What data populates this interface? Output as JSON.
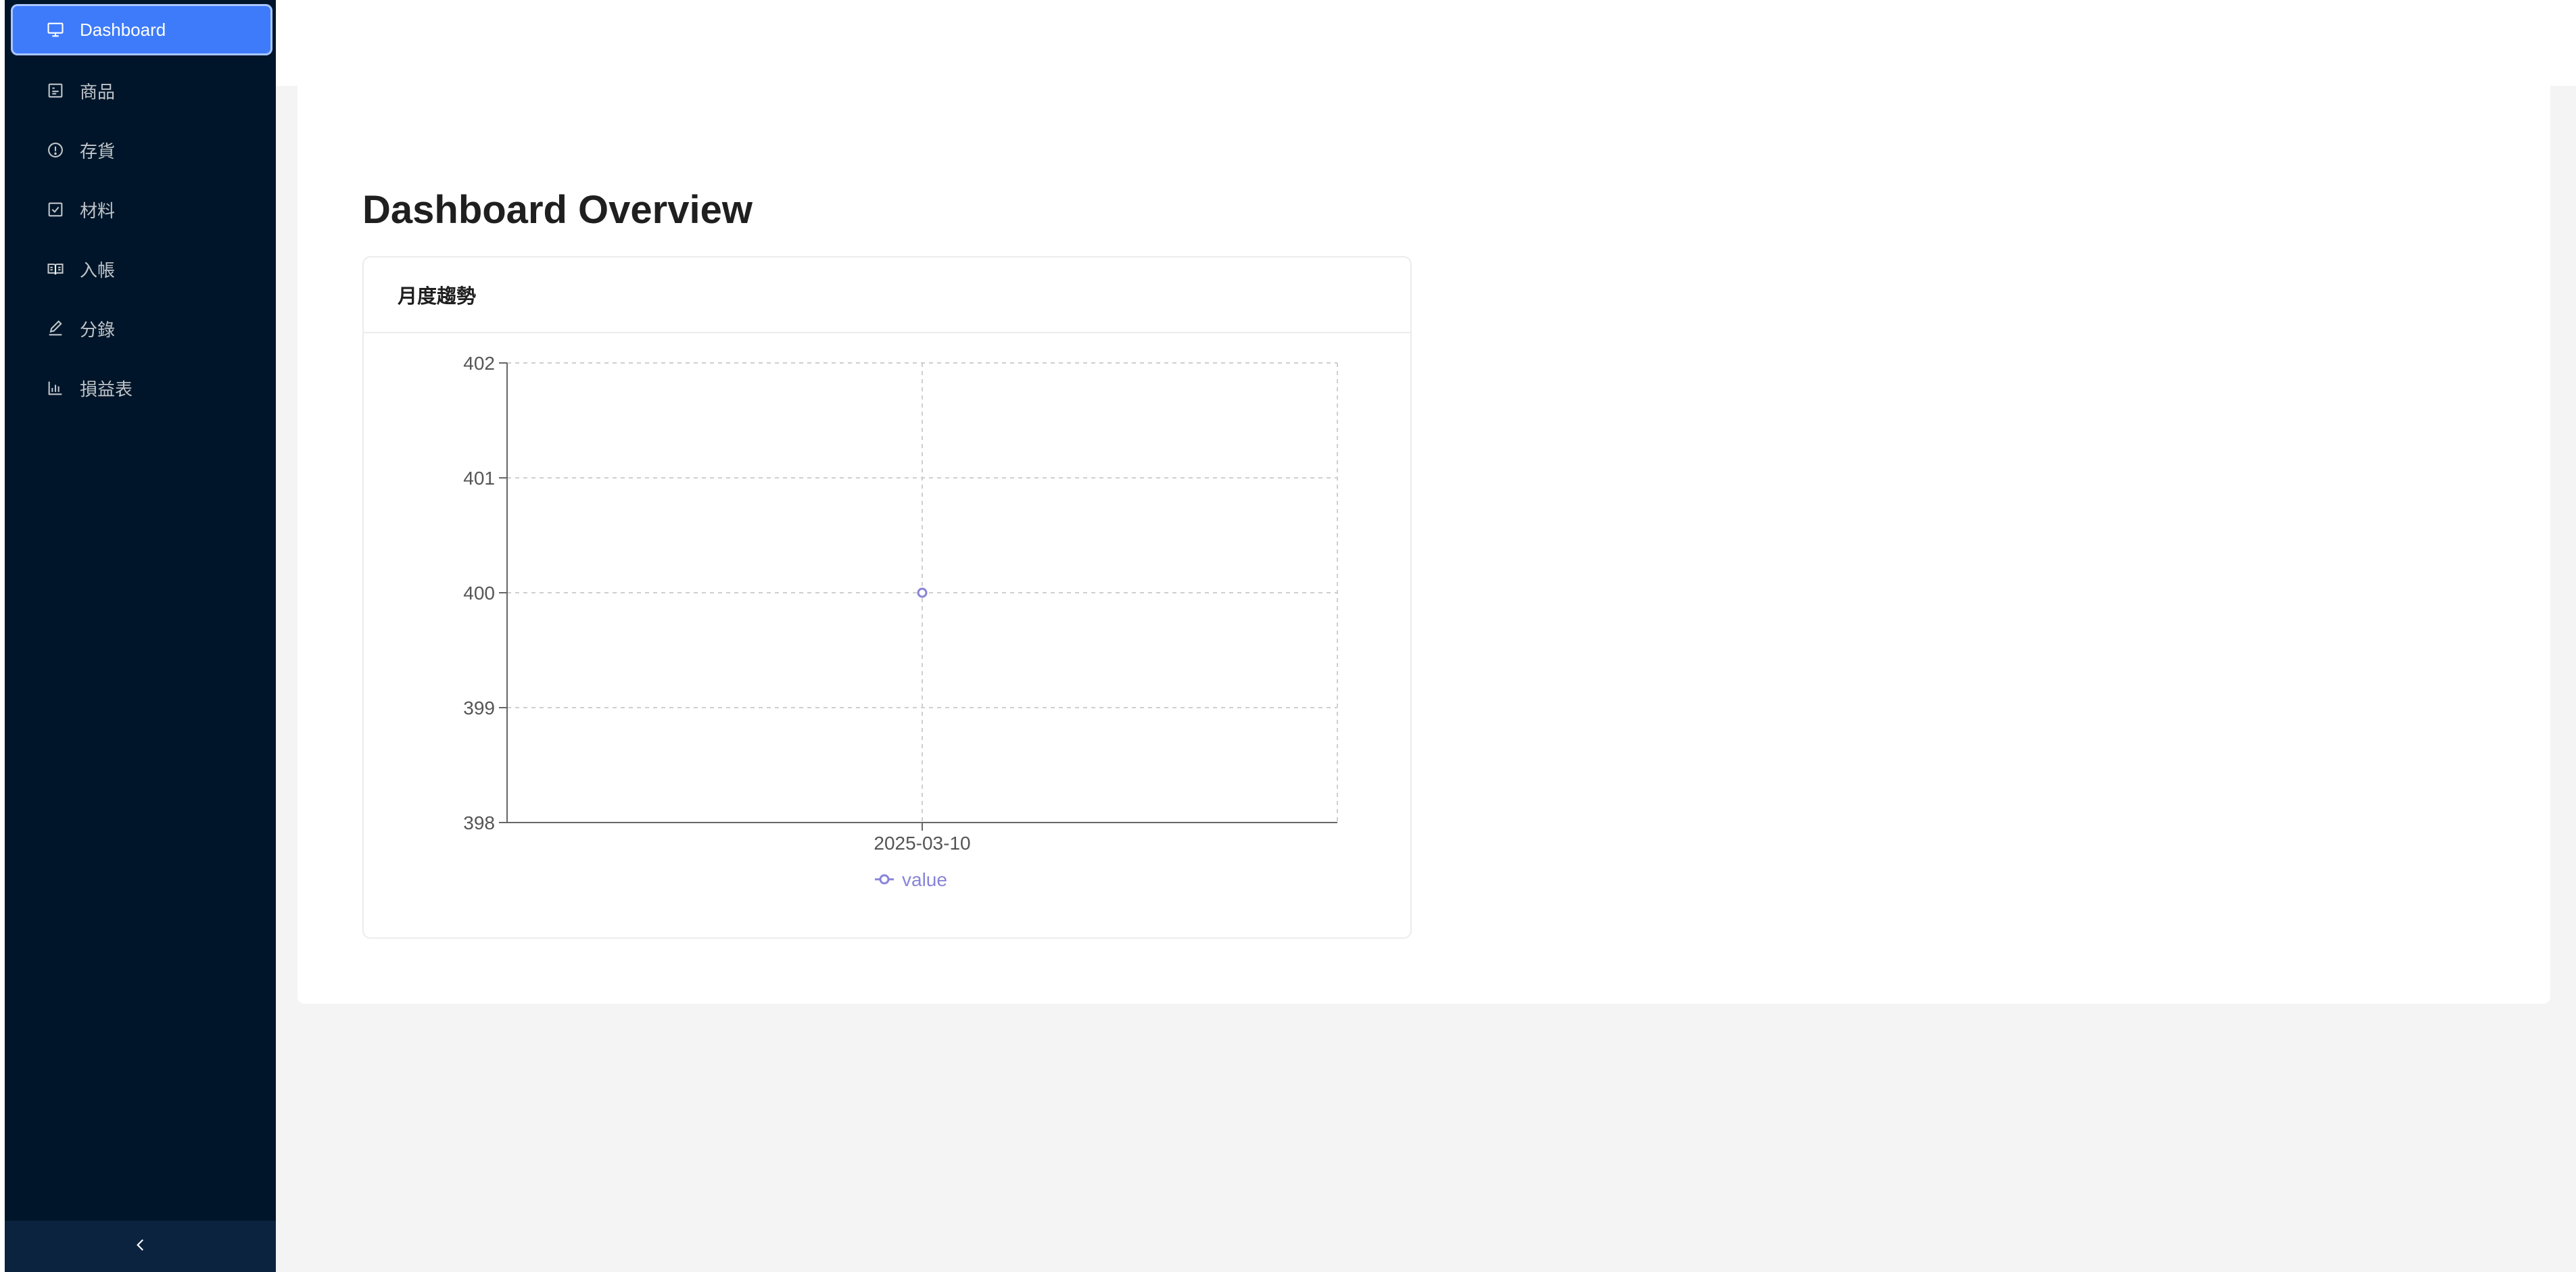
{
  "sidebar": {
    "items": [
      {
        "label": "Dashboard",
        "icon": "desktop-icon",
        "selected": true
      },
      {
        "label": "商品",
        "icon": "product-icon",
        "selected": false
      },
      {
        "label": "存貨",
        "icon": "info-circle-icon",
        "selected": false
      },
      {
        "label": "材料",
        "icon": "check-square-icon",
        "selected": false
      },
      {
        "label": "入帳",
        "icon": "book-icon",
        "selected": false
      },
      {
        "label": "分錄",
        "icon": "edit-icon",
        "selected": false
      },
      {
        "label": "損益表",
        "icon": "bar-chart-icon",
        "selected": false
      }
    ],
    "collapse_icon": "chevron-left-icon"
  },
  "main": {
    "title": "Dashboard Overview",
    "card": {
      "title": "月度趨勢"
    }
  },
  "colors": {
    "sidebar_bg": "#001529",
    "selected_item": "#3e7bfa",
    "series": "#8884d8"
  },
  "chart_data": {
    "type": "line",
    "categories": [
      "2025-03-10"
    ],
    "series": [
      {
        "name": "value",
        "values": [
          400
        ]
      }
    ],
    "xlabel": "",
    "ylabel": "",
    "ylim": [
      398,
      402
    ],
    "yticks": [
      398,
      399,
      400,
      401,
      402
    ],
    "grid": true,
    "legend": "bottom-center"
  }
}
